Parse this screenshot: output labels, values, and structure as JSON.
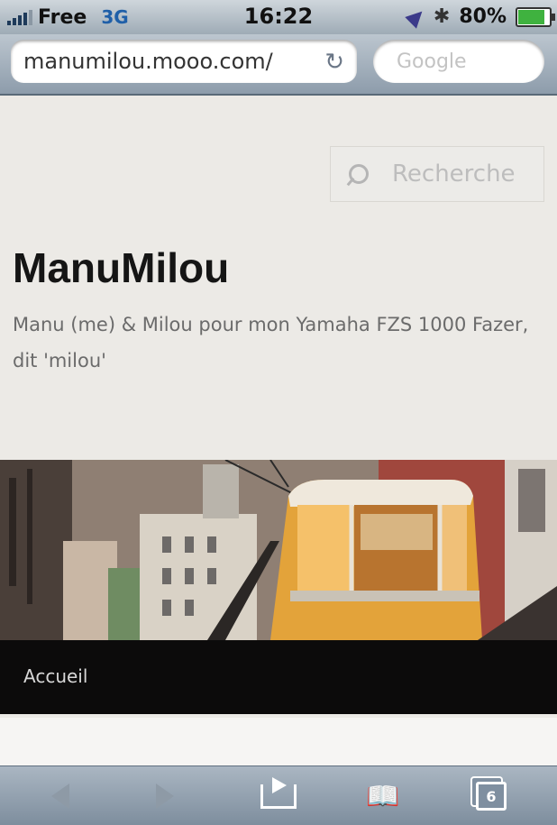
{
  "status_bar": {
    "carrier": "Free",
    "network": "3G",
    "time": "16:22",
    "battery_percent": "80%",
    "battery_level": 0.8,
    "icons": [
      "signal-icon",
      "location-icon",
      "bluetooth-icon",
      "battery-icon"
    ]
  },
  "browser": {
    "url": "manumilou.mooo.com/",
    "search_placeholder": "Google",
    "open_tabs_count": "6"
  },
  "page": {
    "search_placeholder": "Recherche",
    "site_title": "ManuMilou",
    "tagline": "Manu (me) & Milou pour mon Yamaha FZS 1000 Fazer, dit 'milou'",
    "nav_items": [
      "Accueil"
    ]
  },
  "colors": {
    "nav_bg": "#0c0b0b",
    "page_bg": "#eceae6",
    "tram_yellow": "#e3a33a"
  }
}
